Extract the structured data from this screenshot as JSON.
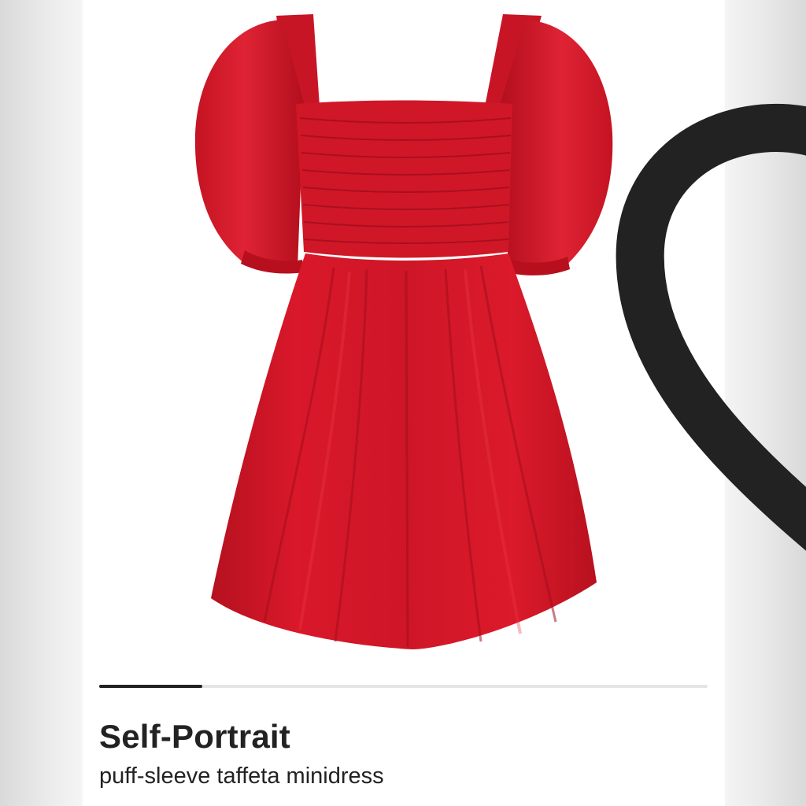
{
  "product": {
    "brand": "Self-Portrait",
    "name": "puff-sleeve taffeta minidress",
    "image_subject": "red puff-sleeve taffeta minidress",
    "dress_color": "#d3182a",
    "dress_shadow_color": "#a90f1d",
    "dress_highlight_color": "#e52a39"
  },
  "wishlist": {
    "icon": "heart-outline-icon",
    "icon_color": "#222222"
  },
  "carousel": {
    "progress_fraction": 0.17,
    "track_color": "#e5e5e5",
    "progress_color": "#222222"
  }
}
